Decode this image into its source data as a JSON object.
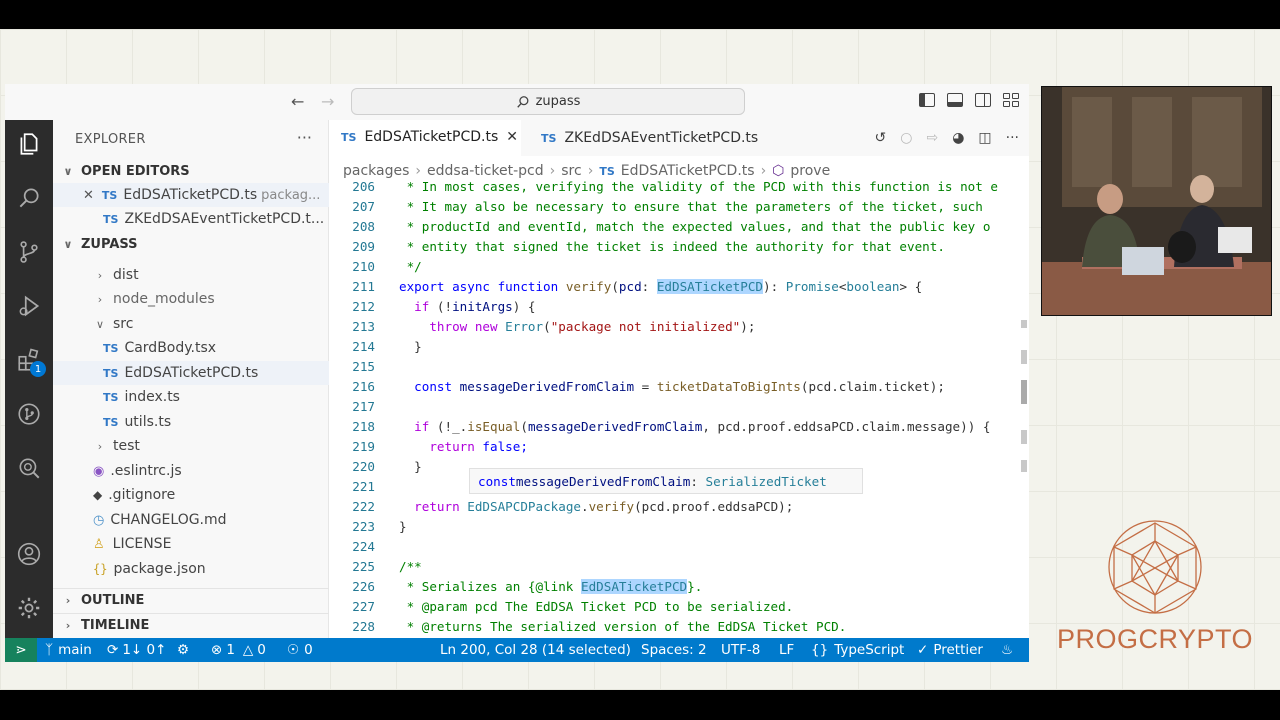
{
  "titlebar": {
    "search_text": "zupass"
  },
  "activity": {
    "extensions_badge": "1"
  },
  "explorer": {
    "title": "EXPLORER",
    "more": "···",
    "open_editors_label": "OPEN EDITORS",
    "open_editors": [
      {
        "name": "EdDSATicketPCD.ts",
        "hint": "packag...",
        "closable": true
      },
      {
        "name": "ZKEdDSAEventTicketPCD.t...",
        "hint": "",
        "closable": false
      }
    ],
    "project_label": "ZUPASS",
    "tree": [
      {
        "label": "dist",
        "kind": "folder",
        "open": false
      },
      {
        "label": "node_modules",
        "kind": "folder",
        "open": false
      },
      {
        "label": "src",
        "kind": "folder",
        "open": true
      },
      {
        "label": "CardBody.tsx",
        "kind": "ts"
      },
      {
        "label": "EdDSATicketPCD.ts",
        "kind": "ts"
      },
      {
        "label": "index.ts",
        "kind": "ts"
      },
      {
        "label": "utils.ts",
        "kind": "ts"
      },
      {
        "label": "test",
        "kind": "folder",
        "open": false
      },
      {
        "label": ".eslintrc.js",
        "kind": "eslint"
      },
      {
        "label": ".gitignore",
        "kind": "git"
      },
      {
        "label": "CHANGELOG.md",
        "kind": "md"
      },
      {
        "label": "LICENSE",
        "kind": "license"
      },
      {
        "label": "package.json",
        "kind": "json"
      }
    ],
    "outline_label": "OUTLINE",
    "timeline_label": "TIMELINE"
  },
  "tabs": [
    {
      "label": "EdDSATicketPCD.ts",
      "active": true
    },
    {
      "label": "ZKEdDSAEventTicketPCD.ts",
      "active": false
    }
  ],
  "breadcrumb": [
    "packages",
    "eddsa-ticket-pcd",
    "src",
    "EdDSATicketPCD.ts",
    "prove"
  ],
  "code": {
    "line_numbers": [
      "206",
      "207",
      "208",
      "209",
      "210",
      "211",
      "212",
      "213",
      "214",
      "215",
      "216",
      "217",
      "218",
      "219",
      "220",
      "221",
      "222",
      "223",
      "224",
      "225",
      "226",
      "227",
      "228"
    ],
    "l206": " * In most cases, verifying the validity of the PCD with this function is not e",
    "l207": " * It may also be necessary to ensure that the parameters of the ticket, such",
    "l208": " * productId and eventId, match the expected values, and that the public key o",
    "l209": " * entity that signed the ticket is indeed the authority for that event.",
    "l210": " */",
    "l211a": "export async function",
    "l211b": "verify",
    "l211c": "(",
    "l211d": "pcd",
    "l211e": ": ",
    "l211f": "EdDSATicketPCD",
    "l211g": "): ",
    "l211h": "Promise",
    "l211i": "<",
    "l211j": "boolean",
    "l211k": "> {",
    "l212a": "  if",
    "l212b": " (!",
    "l212c": "initArgs",
    "l212d": ") {",
    "l213a": "    throw new",
    "l213b": "Error",
    "l213c": "(",
    "l213d": "\"package not initialized\"",
    "l213e": ");",
    "l214": "  }",
    "hover": {
      "kw": "const",
      "name": "messageDerivedFromClaim",
      "sep": ": ",
      "type": "SerializedTicket"
    },
    "l216a": "  const",
    "l216b": "messageDerivedFromClaim",
    "l216c": " = ",
    "l216d": "ticketDataToBigInts",
    "l216e": "(pcd.claim.ticket);",
    "l218a": "  if",
    "l218b": " (!_.",
    "l218c": "isEqual",
    "l218d": "(",
    "l218e": "messageDerivedFromClaim",
    "l218f": ", pcd.proof.eddsaPCD.claim.message)) {",
    "l219a": "    return",
    "l219b": " false;",
    "l220": "  }",
    "l222a": "  return",
    "l222b": "EdDSAPCDPackage",
    "l222c": ".",
    "l222d": "verify",
    "l222e": "(pcd.proof.eddsaPCD);",
    "l223": "}",
    "l225": "/**",
    "l226a": " * Serializes an {@link ",
    "l226b": "EdDSATicketPCD",
    "l226c": "}.",
    "l227": " * @param pcd The EdDSA Ticket PCD to be serialized.",
    "l228": " * @returns The serialized version of the EdDSA Ticket PCD."
  },
  "status": {
    "branch": "main",
    "sync": "1↓ 0↑",
    "errors": "1",
    "warnings": "0",
    "ports": "0",
    "position": "Ln 200, Col 28 (14 selected)",
    "spaces": "Spaces: 2",
    "encoding": "UTF-8",
    "eol": "LF",
    "language": "TypeScript",
    "formatter": "Prettier"
  },
  "logo": {
    "text": "PROGCRYPTO",
    "color": "#c46e45"
  },
  "colors": {
    "statusbar": "#007acc",
    "activitybar": "#2c2c2c",
    "accent": "#0078d4"
  }
}
